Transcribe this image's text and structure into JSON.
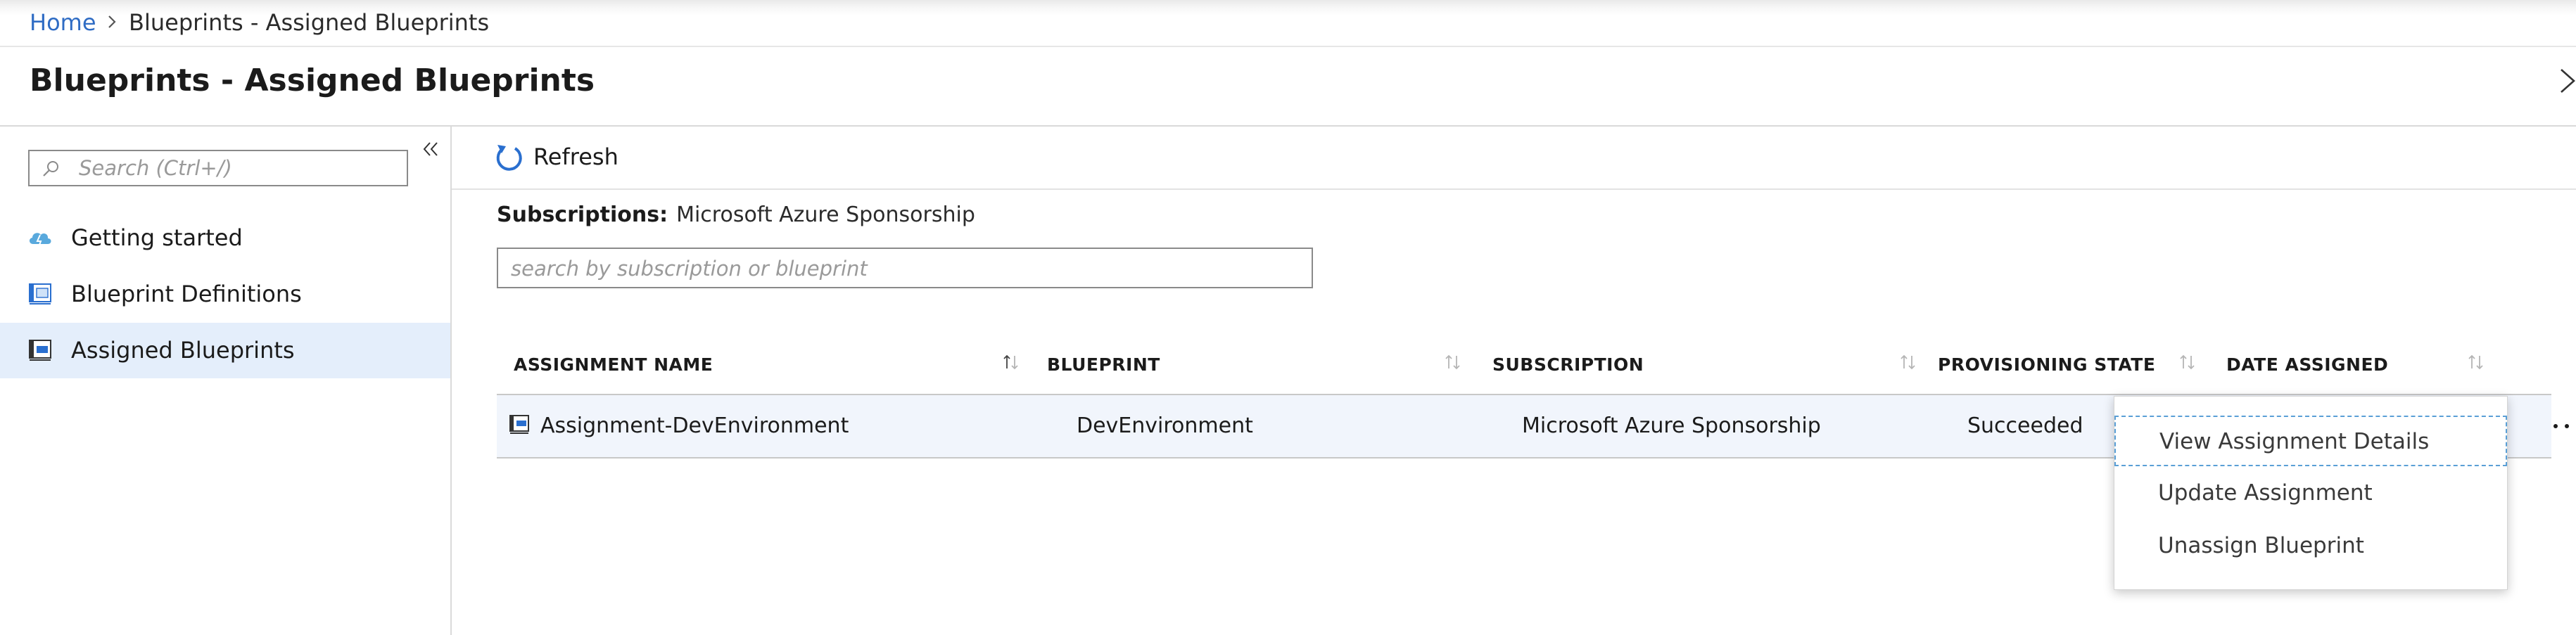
{
  "breadcrumb": {
    "home": "Home",
    "current": "Blueprints - Assigned Blueprints"
  },
  "page": {
    "title": "Blueprints - Assigned Blueprints"
  },
  "sidebar": {
    "search_placeholder": "Search (Ctrl+/)",
    "items": [
      {
        "label": "Getting started",
        "icon": "cloud-icon",
        "selected": false
      },
      {
        "label": "Blueprint Definitions",
        "icon": "blueprint-definitions-icon",
        "selected": false
      },
      {
        "label": "Assigned Blueprints",
        "icon": "assigned-blueprint-icon",
        "selected": true
      }
    ]
  },
  "toolbar": {
    "refresh_label": "Refresh"
  },
  "filter": {
    "subscriptions_label": "Subscriptions:",
    "subscriptions_value": "Microsoft Azure Sponsorship",
    "search_placeholder": "search by subscription or blueprint"
  },
  "grid": {
    "columns": [
      "ASSIGNMENT NAME",
      "BLUEPRINT",
      "SUBSCRIPTION",
      "PROVISIONING STATE",
      "DATE ASSIGNED"
    ],
    "rows": [
      {
        "assignment_name": "Assignment-DevEnvironment",
        "blueprint": "DevEnvironment",
        "subscription": "Microsoft Azure Sponsorship",
        "provisioning_state": "Succeeded",
        "date_assigned": ""
      }
    ]
  },
  "context_menu": {
    "items": [
      {
        "label": "View Assignment Details",
        "focused": true
      },
      {
        "label": "Update Assignment",
        "focused": false
      },
      {
        "label": "Unassign Blueprint",
        "focused": false
      }
    ]
  },
  "colors": {
    "link": "#2f6cc4",
    "selected_bg": "#e4eefb",
    "row_bg": "#f1f5fc",
    "accent_blue": "#2a6fcf",
    "focus_outline": "#5a9fd6"
  }
}
